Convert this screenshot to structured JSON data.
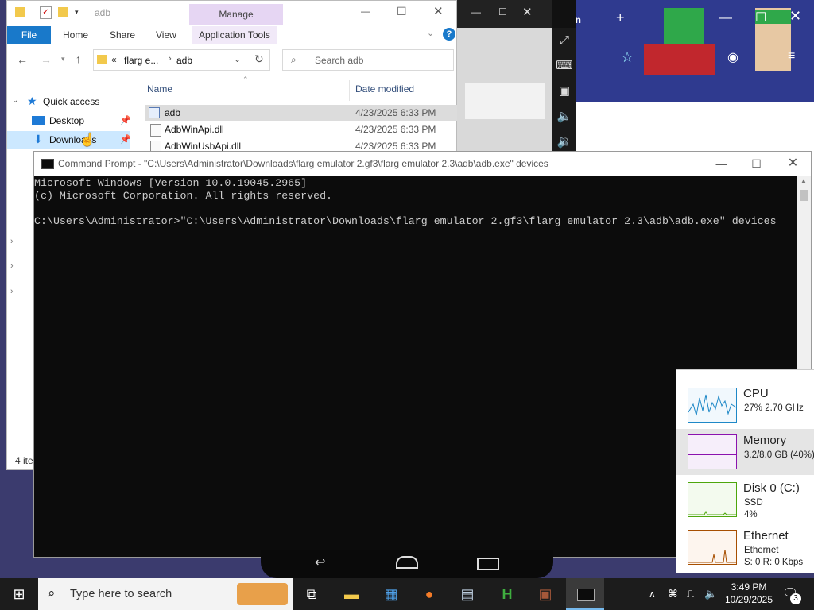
{
  "explorer": {
    "title": "adb",
    "manage": "Manage",
    "tabs": [
      "File",
      "Home",
      "Share",
      "View",
      "Application Tools"
    ],
    "address": [
      "flarg e...",
      "adb"
    ],
    "search_placeholder": "Search adb",
    "nav": {
      "quick_access": "Quick access",
      "desktop": "Desktop",
      "downloads": "Downloads"
    },
    "columns": {
      "name": "Name",
      "date": "Date modified"
    },
    "files": [
      {
        "name": "adb",
        "date": "4/23/2025 6:33 PM"
      },
      {
        "name": "AdbWinApi.dll",
        "date": "4/23/2025 6:33 PM"
      },
      {
        "name": "AdbWinUsbApi.dll",
        "date": "4/23/2025 6:33 PM"
      }
    ],
    "status": "4 ite"
  },
  "cmd": {
    "title": "Command Prompt - \"C:\\Users\\Administrator\\Downloads\\flarg emulator 2.gf3\\flarg emulator 2.3\\adb\\adb.exe\"  devices",
    "lines": [
      "Microsoft Windows [Version 10.0.19045.2965]",
      "(c) Microsoft Corporation. All rights reserved.",
      "",
      "C:\\Users\\Administrator>\"C:\\Users\\Administrator\\Downloads\\flarg emulator 2.gf3\\flarg emulator 2.3\\adb\\adb.exe\" devices"
    ]
  },
  "browser": {
    "tab_text": "al on"
  },
  "taskmgr": {
    "cpu": {
      "name": "CPU",
      "s1": "27%  2.70 GHz",
      "color": "#1e88c7"
    },
    "memory": {
      "name": "Memory",
      "s1": "3.2/8.0 GB (40%)",
      "color": "#8b12ae"
    },
    "disk": {
      "name": "Disk 0 (C:)",
      "s1": "SSD",
      "s2": "4%",
      "color": "#4da60c"
    },
    "ethernet": {
      "name": "Ethernet",
      "s1": "Ethernet",
      "s2": "S: 0  R: 0 Kbps",
      "color": "#a74f01"
    }
  },
  "taskbar": {
    "search_placeholder": "Type here to search",
    "time": "3:49 PM",
    "date": "10/29/2025",
    "notifications": "3"
  }
}
